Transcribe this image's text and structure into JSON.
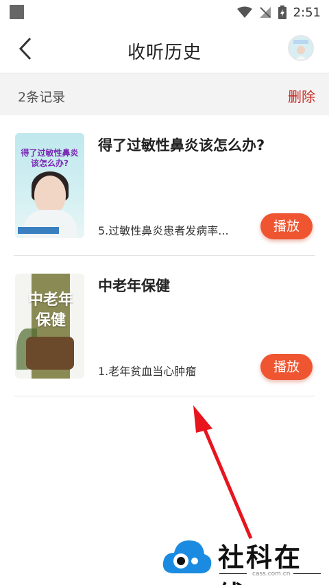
{
  "status_bar": {
    "time": "2:51"
  },
  "header": {
    "title": "收听历史",
    "back_icon": "chevron-left-icon"
  },
  "record_bar": {
    "count_label": "2条记录",
    "delete_label": "删除"
  },
  "items": [
    {
      "title": "得了过敏性鼻炎该怎么办?",
      "subtitle": "5.过敏性鼻炎患者发病率...",
      "play_label": "播放",
      "cover_title": "得了过敏性鼻炎该怎么办?"
    },
    {
      "title": "中老年保健",
      "subtitle": "1.老年贫血当心肿瘤",
      "play_label": "播放",
      "cover_title_line1": "中老年",
      "cover_title_line2": "保健"
    }
  ],
  "watermark": {
    "brand": "社科在线",
    "url": "cass.com.cn"
  },
  "colors": {
    "accent": "#ee5530",
    "delete": "#c62a20",
    "arrow": "#e8141e"
  }
}
